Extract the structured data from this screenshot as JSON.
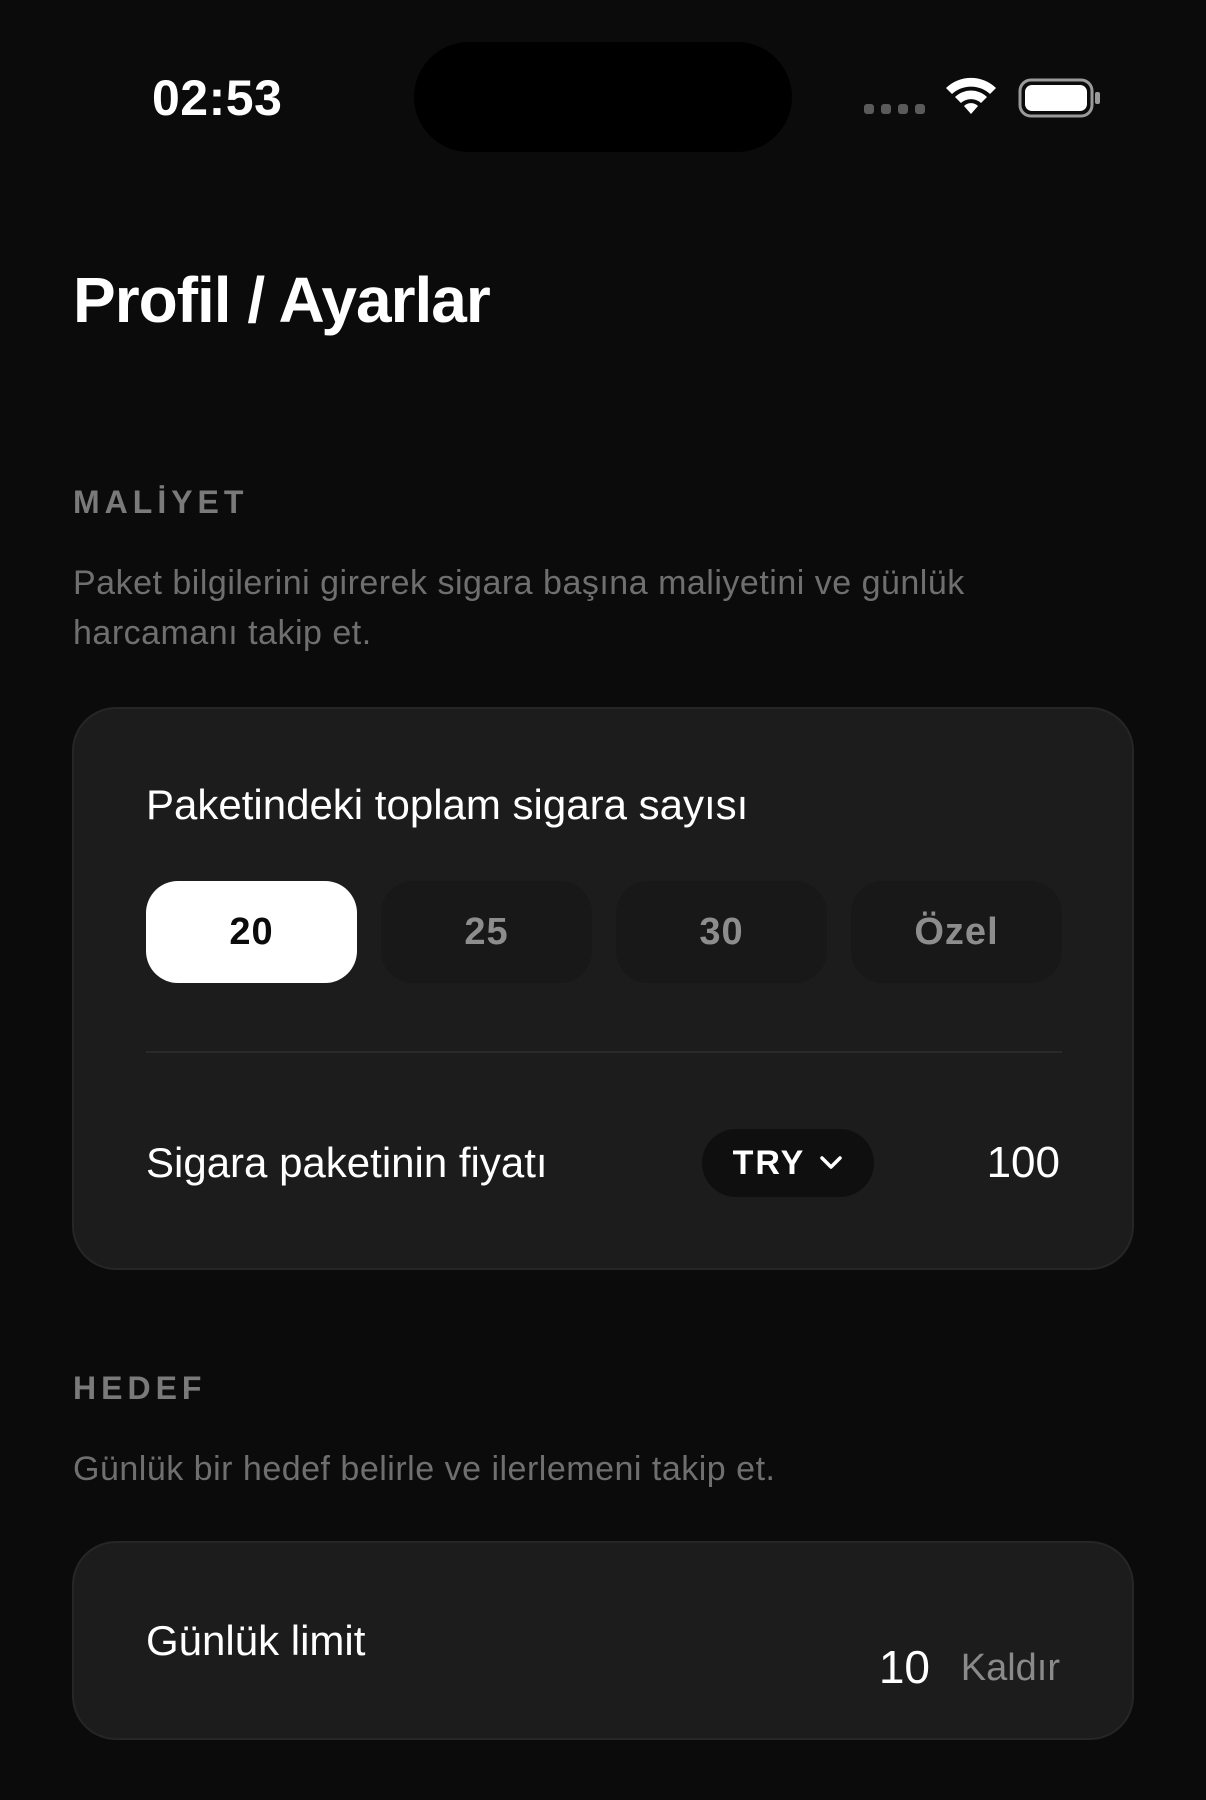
{
  "status_bar": {
    "time": "02:53",
    "wifi_icon": "wifi-icon",
    "battery_icon": "battery-icon"
  },
  "page": {
    "title": "Profil / Ayarlar"
  },
  "cost_section": {
    "heading": "MALİYET",
    "description": "Paket bilgilerini girerek sigara başına maliyetini ve günlük harcamanı takip et.",
    "pack_size_label": "Paketindeki toplam sigara sayısı",
    "pack_size_options": [
      "20",
      "25",
      "30",
      "Özel"
    ],
    "selected_pack_size": "20",
    "price_label": "Sigara paketinin fiyatı",
    "currency": "TRY",
    "price_value": "100"
  },
  "goal_section": {
    "heading": "HEDEF",
    "description": "Günlük bir hedef belirle ve ilerlemeni takip et.",
    "daily_limit_label": "Günlük limit",
    "daily_limit_value": "10",
    "remove_label": "Kaldır"
  },
  "colors": {
    "background": "#0b0b0b",
    "card": "#1c1c1c",
    "muted_text": "#6f6f6f",
    "selected_segment": "#ffffff"
  }
}
